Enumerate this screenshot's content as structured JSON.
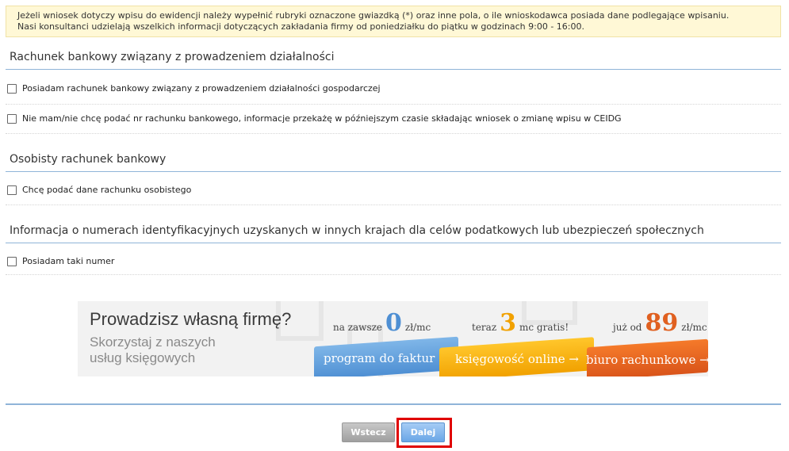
{
  "notice": {
    "line1": "Jeżeli wniosek dotyczy wpisu do ewidencji należy wypełnić rubryki oznaczone gwiazdką (*) oraz inne pola, o ile wnioskodawca posiada dane podlegające wpisaniu.",
    "line2": "Nasi konsultanci udzielają wszelkich informacji dotyczących zakładania firmy od poniedziałku do piątku w godzinach 9:00 - 16:00."
  },
  "sections": {
    "bank": {
      "title": "Rachunek bankowy związany z prowadzeniem działalności",
      "options": [
        "Posiadam rachunek bankowy związany z prowadzeniem działalności gospodarczej",
        "Nie mam/nie chcę podać nr rachunku bankowego, informacje przekażę w późniejszym czasie składając wniosek o zmianę wpisu w CEIDG"
      ]
    },
    "personal": {
      "title": "Osobisty rachunek bankowy",
      "options": [
        "Chcę podać dane rachunku osobistego"
      ]
    },
    "foreign": {
      "title": "Informacja o numerach identyfikacyjnych uzyskanych w innych krajach dla celów podatkowych lub ubezpieczeń społecznych",
      "options": [
        "Posiadam taki numer"
      ]
    }
  },
  "banner": {
    "headline": "Prowadzisz własną firmę?",
    "subline": "Skorzystaj z naszych usług księgowych",
    "offers": [
      {
        "prefix": "na zawsze",
        "big": "0",
        "suffix": "zł/mc",
        "button": "program do faktur →",
        "color": "#4e8fd3",
        "big_color": "#4e8fd3"
      },
      {
        "prefix": "teraz",
        "big": "3",
        "suffix": "mc gratis!",
        "button": "księgowość online →",
        "color": "#f1a100",
        "big_color": "#f1a100"
      },
      {
        "prefix": "już od",
        "big": "89",
        "suffix": "zł/mc",
        "button": "biuro rachunkowe →",
        "color": "#d9541a",
        "big_color": "#e06020"
      }
    ]
  },
  "nav": {
    "back_label": "Wstecz",
    "next_label": "Dalej"
  }
}
